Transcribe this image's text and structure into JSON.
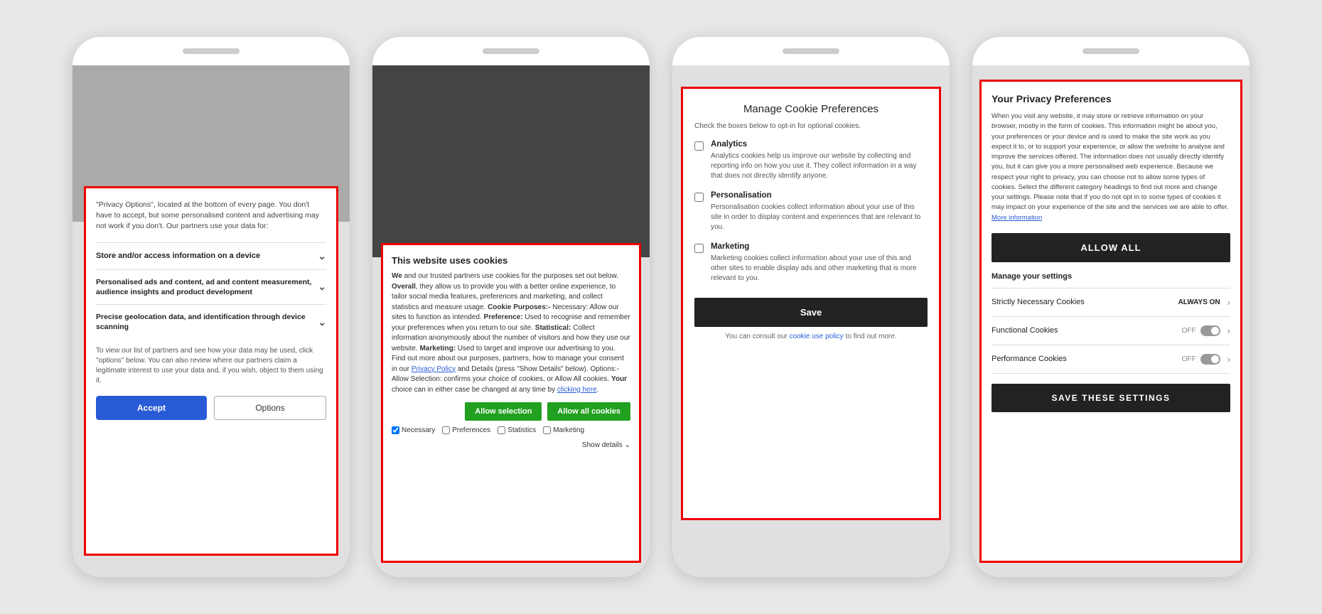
{
  "phone1": {
    "intro": "\"Privacy Options\", located at the bottom of every page. You don't have to accept, but some personalised content and advertising may not work if you don't. Our partners use your data for:",
    "items": [
      "Store and/or access information on a device",
      "Personalised ads and content, ad and content measurement, audience insights and product development",
      "Precise geolocation data, and identification through device scanning"
    ],
    "footer": "To view our list of partners and see how your data may be used, click \"options\" below. You can also review where our partners claim a legitimate interest to use your data and, if you wish, object to them using it.",
    "accept_label": "Accept",
    "options_label": "Options"
  },
  "phone2": {
    "title": "This website uses cookies",
    "body_parts": [
      {
        "text": "We",
        "bold": false
      },
      {
        "text": " and our trusted partners use cookies for the purposes set out below. ",
        "bold": false
      },
      {
        "text": "Overall",
        "bold": true
      },
      {
        "text": ", they allow us to provide you with a better online experience, to tailor social media features, preferences and marketing, and collect statistics and measure usage. ",
        "bold": false
      },
      {
        "text": "Cookie Purposes:-",
        "bold": true
      },
      {
        "text": " Necessary:",
        "bold": false
      },
      {
        "text": " Allow our sites to function as intended. ",
        "bold": false
      },
      {
        "text": "Preference:",
        "bold": true
      },
      {
        "text": " Used to recognise and remember your preferences when you return to our site. ",
        "bold": false
      },
      {
        "text": "Statistical:",
        "bold": true
      },
      {
        "text": " Collect information anonymously about the number of visitors and how they use our website. ",
        "bold": false
      },
      {
        "text": "Marketing:",
        "bold": true
      },
      {
        "text": " Used to target and improve our advertising to you. Find out more about our purposes, partners, how to manage your consent in our ",
        "bold": false
      }
    ],
    "privacy_link": "Privacy Policy",
    "body_end": " and Details (press \"Show Details\" below). ",
    "options_label": "Options:- Allow Selection:",
    "options_text": " confirms your choice of cookies, or ",
    "allow_all_text": "Allow All cookies",
    "allow_all_end": ". Your choice can in either case be changed at any time by ",
    "clicking_link": "clicking here",
    "btn_selection": "Allow selection",
    "btn_all": "Allow all cookies",
    "checkboxes": [
      {
        "label": "Necessary",
        "checked": true
      },
      {
        "label": "Preferences",
        "checked": false
      },
      {
        "label": "Statistics",
        "checked": false
      },
      {
        "label": "Marketing",
        "checked": false
      }
    ],
    "show_details": "Show details"
  },
  "phone3": {
    "title": "Manage Cookie Preferences",
    "subtitle": "Check the boxes below to opt-in for optional cookies.",
    "options": [
      {
        "label": "Analytics",
        "desc": "Analytics cookies help us improve our website by collecting and reporting info on how you use it. They collect information in a way that does not directly identify anyone."
      },
      {
        "label": "Personalisation",
        "desc": "Personalisation cookies collect information about your use of this site in order to display content and experiences that are relevant to you."
      },
      {
        "label": "Marketing",
        "desc": "Marketing cookies collect information about your use of this and other sites to enable display ads and other marketing that is more relevant to you."
      }
    ],
    "save_label": "Save",
    "consult_text": "You can consult our",
    "consult_link": "cookie use policy",
    "consult_end": "to find out more."
  },
  "phone4": {
    "title": "Your Privacy Preferences",
    "body": "When you visit any website, it may store or retrieve information on your browser, mostly in the form of cookies. This information might be about you, your preferences or your device and is used to make the site work as you expect it to, or to support your experience, or allow the website to analyse and improve the services offered. The information does not usually directly identify you, but it can give you a more personalised web experience. Because we respect your right to privacy, you can choose not to allow some types of cookies. Select the different category headings to find out more and change your settings. Please note that if you do not opt in to some types of cookies it may impact on your experience of the site and the services we are able to offer.",
    "more_info_link": "More information",
    "allow_all_label": "ALLOW ALL",
    "manage_label": "Manage your settings",
    "settings": [
      {
        "label": "Strictly Necessary Cookies",
        "state": "ALWAYS ON",
        "type": "always-on"
      },
      {
        "label": "Functional Cookies",
        "state": "OFF",
        "type": "toggle"
      },
      {
        "label": "Performance Cookies",
        "state": "OFF",
        "type": "toggle"
      }
    ],
    "save_label": "SAVE THESE SETTINGS"
  },
  "colors": {
    "red_border": "#dd0000",
    "accept_btn": "#2a5bd7",
    "green_btn": "#22a020",
    "dark_btn": "#222222"
  }
}
